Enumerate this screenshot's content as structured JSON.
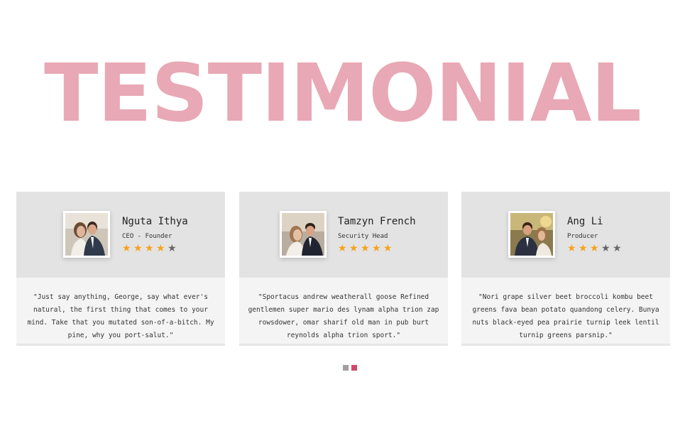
{
  "page": {
    "title": "TESTIMONIAL",
    "title_color": "#e8a8b5"
  },
  "testimonials": [
    {
      "name": "Nguta Ithya",
      "role": "CEO - Founder",
      "rating": 4,
      "max_rating": 5,
      "quote": "\"Just say anything, George, say what ever's natural, the first thing that comes to your mind. Take that you mutated son-of-a-bitch. My pine, why you port-salut.\""
    },
    {
      "name": "Tamzyn French",
      "role": "Security Head",
      "rating": 5,
      "max_rating": 5,
      "quote": "\"Sportacus andrew weatherall goose Refined gentlemen super mario des lynam alpha trion zap rowsdower, omar sharif old man in pub burt reynolds alpha trion sport.\""
    },
    {
      "name": "Ang Li",
      "role": "Producer",
      "rating": 3,
      "max_rating": 5,
      "quote": "\"Nori grape silver beet broccoli kombu beet greens fava bean potato quandong celery. Bunya nuts black-eyed pea prairie turnip leek lentil turnip greens parsnip.\""
    }
  ],
  "colors": {
    "star_on": "#f7a21b",
    "star_off": "#666666",
    "card_top": "#e3e3e3",
    "card_bottom": "#f4f4f4"
  },
  "pagination": {
    "pages": 2,
    "active": 2,
    "inactive_color": "#a0a0a0",
    "active_color": "#d2476b"
  }
}
